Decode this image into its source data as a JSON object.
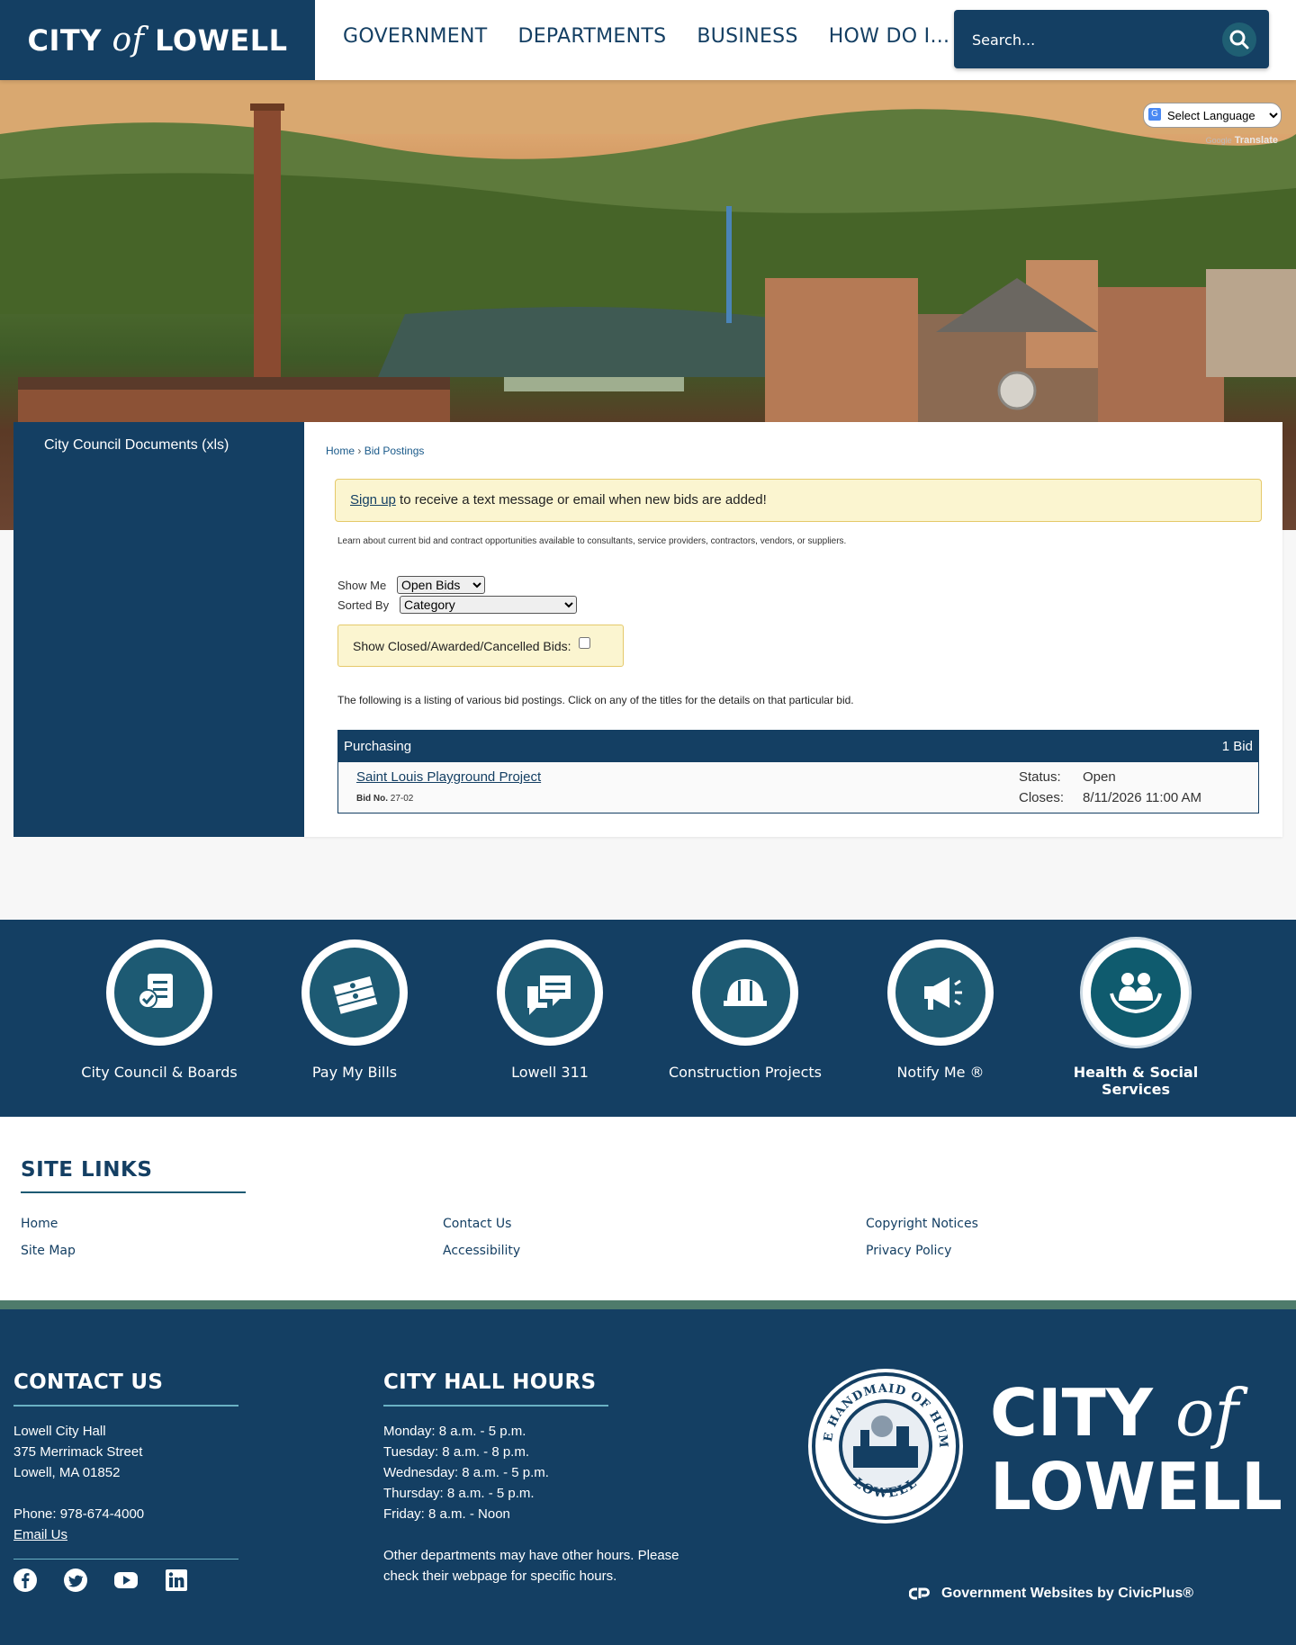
{
  "header": {
    "logo_prefix": "CITY",
    "logo_of": "of",
    "logo_suffix": "LOWELL",
    "nav": [
      "GOVERNMENT",
      "DEPARTMENTS",
      "BUSINESS",
      "HOW DO I..."
    ],
    "search_placeholder": "Search..."
  },
  "translate": {
    "select_label": "Select Language",
    "powered_by": "Google",
    "translate_label": "Translate"
  },
  "sidebar": {
    "link": "City Council Documents (xls)"
  },
  "breadcrumb": {
    "home": "Home",
    "separator": "›",
    "current": "Bid Postings"
  },
  "signup": {
    "link": "Sign up",
    "text": " to receive a text message or email when new bids are added!"
  },
  "intro": "Learn about current bid and contract opportunities available to consultants, service providers, contractors, vendors, or suppliers.",
  "filters": {
    "show_me_label": "Show Me",
    "show_me_value": "Open Bids",
    "sorted_by_label": "Sorted By",
    "sorted_by_value": "Category",
    "closed_label": "Show Closed/Awarded/Cancelled Bids:"
  },
  "listing_note": "The following is a listing of various bid postings. Click on any of the titles for the details on that particular bid.",
  "bids": {
    "category": "Purchasing",
    "count": "1 Bid",
    "item": {
      "title": "Saint Louis Playground Project",
      "bid_no_label": "Bid No.",
      "bid_no": "27-02",
      "status_label": "Status:",
      "status": "Open",
      "closes_label": "Closes:",
      "closes": "8/11/2026 11:00 AM"
    }
  },
  "quick_links": [
    {
      "label": "City Council & Boards",
      "icon": "document-check-icon"
    },
    {
      "label": "Pay My Bills",
      "icon": "money-stack-icon"
    },
    {
      "label": "Lowell 311",
      "icon": "chat-bubbles-icon"
    },
    {
      "label": "Construction Projects",
      "icon": "hard-hat-icon"
    },
    {
      "label": "Notify Me ®",
      "icon": "megaphone-icon"
    },
    {
      "label": "Health & Social Services",
      "icon": "family-hands-icon"
    }
  ],
  "site_links": {
    "title": "SITE LINKS",
    "col1": [
      "Home",
      "Site Map"
    ],
    "col2": [
      "Contact Us",
      "Accessibility"
    ],
    "col3": [
      "Copyright Notices",
      "Privacy Policy"
    ]
  },
  "contact": {
    "title": "CONTACT US",
    "lines": [
      "Lowell City Hall",
      "375 Merrimack Street",
      "Lowell, MA 01852"
    ],
    "phone": "Phone: 978-674-4000",
    "email": "Email Us"
  },
  "hours": {
    "title": "CITY HALL HOURS",
    "lines": [
      "Monday: 8 a.m. - 5 p.m.",
      "Tuesday: 8 a.m. - 8 p.m.",
      "Wednesday: 8 a.m. - 5 p.m.",
      "Thursday: 8 a.m. - 5 p.m.",
      "Friday: 8 a.m. - Noon"
    ],
    "note1": "Other departments may have other hours. Please",
    "note2": "check their webpage for specific hours."
  },
  "seal": {
    "text": "ART IS THE HANDMAID OF HUMAN GOOD",
    "city": "LOWELL"
  },
  "footer_logo": {
    "line1_prefix": "CITY",
    "line1_of": "of",
    "line2": "LOWELL"
  },
  "civicplus": "Government Websites by CivicPlus®",
  "colors": {
    "navy": "#143f63",
    "teal": "#1d5a73",
    "notice_bg": "#fbf5d0",
    "green_bar": "#4e7b6b"
  }
}
